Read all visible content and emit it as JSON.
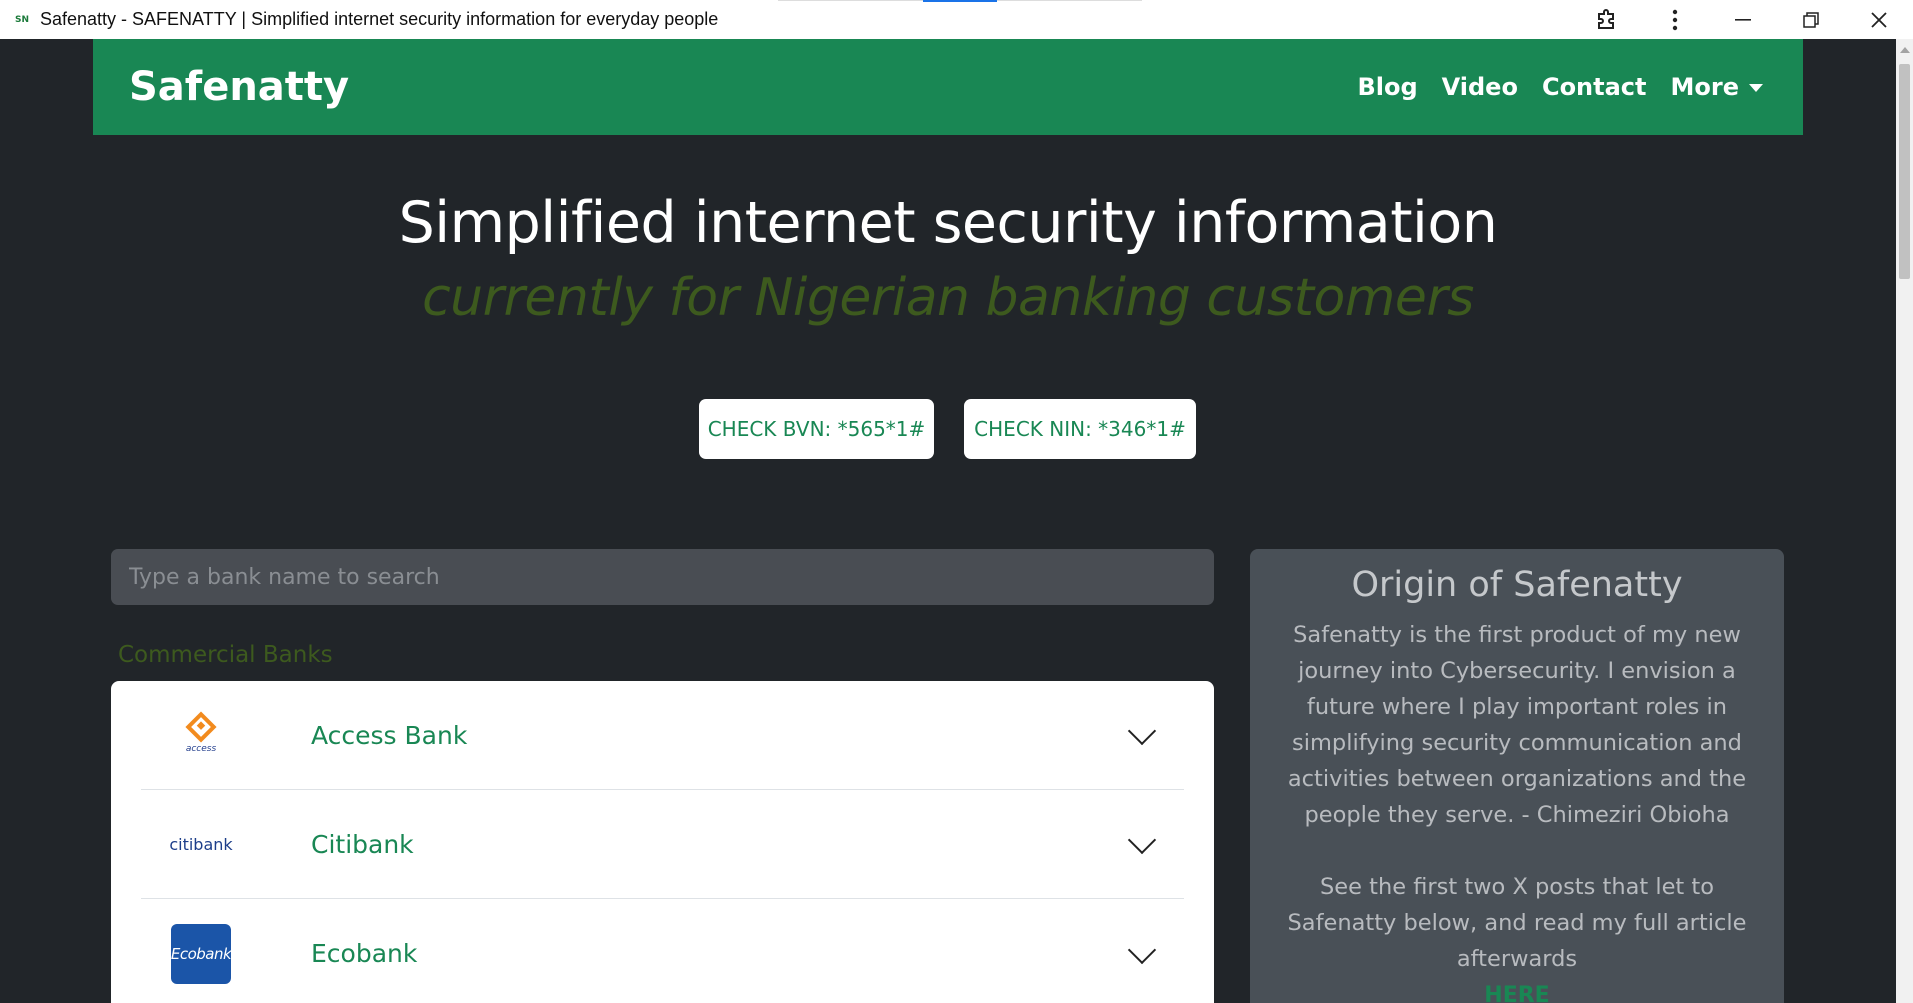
{
  "window": {
    "favicon_text": "SN",
    "title": "Safenatty - SAFENATTY | Simplified internet security information for everyday people"
  },
  "navbar": {
    "brand": "Safenatty",
    "links": [
      "Blog",
      "Video",
      "Contact",
      "More"
    ]
  },
  "hero": {
    "title": "Simplified internet security information",
    "subtitle": "currently for Nigerian banking customers",
    "buttons": {
      "bvn": "CHECK BVN: *565*1#",
      "nin": "CHECK NIN: *346*1#"
    }
  },
  "search": {
    "placeholder": "Type a bank name to search"
  },
  "banks": {
    "section_label": "Commercial Banks",
    "items": [
      {
        "name": "Access Bank",
        "logo": "access-logo",
        "logo_text": "access"
      },
      {
        "name": "Citibank",
        "logo": "citibank-logo",
        "logo_text": "citibank"
      },
      {
        "name": "Ecobank",
        "logo": "ecobank-logo",
        "logo_text": "Ecobank"
      }
    ]
  },
  "origin": {
    "title": "Origin of Safenatty",
    "body": "Safenatty is the first product of my new journey into Cybersecurity. I envision a future where I play important roles in simplifying security communication and activities between organizations and the people they serve. - Chimeziri Obioha",
    "posts_text": "See the first two X posts that let to Safenatty below, and read my full article afterwards",
    "link_text": "HERE"
  },
  "colors": {
    "brand_green": "#198754",
    "page_bg": "#212529",
    "subtitle_olive": "#3d5a1e",
    "card_dark": "#495057"
  }
}
